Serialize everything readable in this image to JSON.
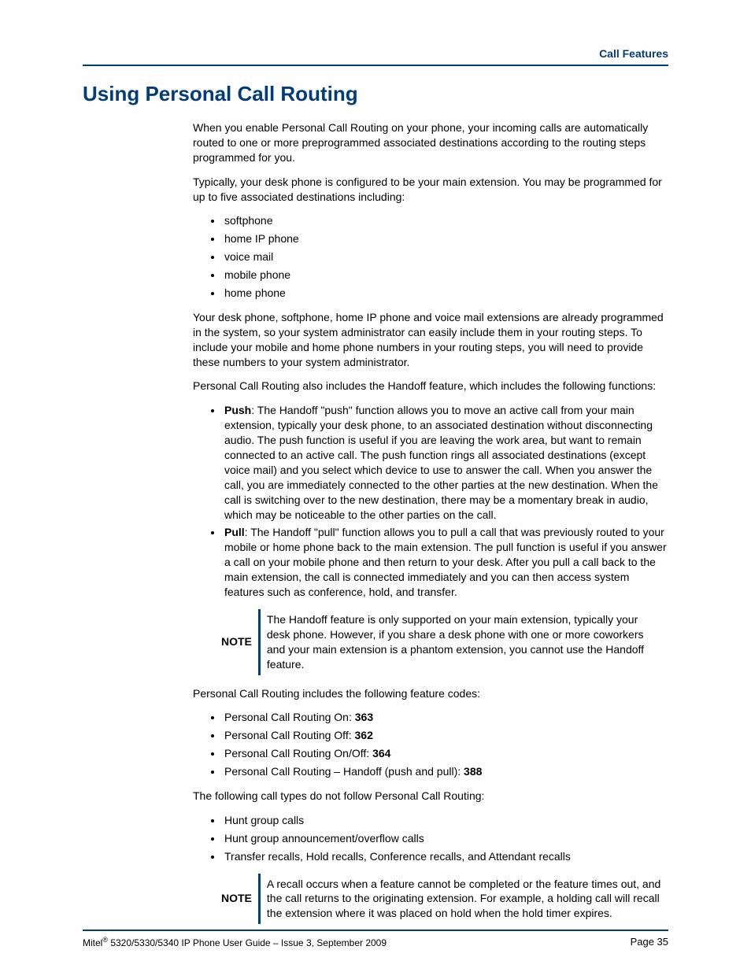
{
  "header": {
    "section": "Call Features"
  },
  "title": "Using Personal Call Routing",
  "p1": "When you enable Personal Call Routing on your phone, your incoming calls are automatically routed to one or more preprogrammed associated destinations according to the routing steps programmed for you.",
  "p2": "Typically, your desk phone is configured to be your main extension. You may be programmed for up to five associated destinations including:",
  "dest": [
    "softphone",
    "home IP phone",
    "voice mail",
    "mobile phone",
    "home phone"
  ],
  "p3": "Your desk phone, softphone, home IP phone and voice mail extensions are already programmed in the system, so your system administrator can easily include them in your routing steps. To include your mobile and home phone numbers in your routing steps, you will need to provide these numbers to your system administrator.",
  "p4": "Personal Call Routing also includes the Handoff feature, which includes the following functions:",
  "push": {
    "label": "Push",
    "text": ": The Handoff \"push\" function allows you to move an active call from your main extension, typically your desk phone, to an associated destination without disconnecting audio. The push function is useful if you are leaving the work area, but want to remain connected to an active call. The push function rings all associated destinations (except voice mail) and you select which device to use to answer the call. When you answer the call, you are immediately connected to the other parties at the new destination. When the call is switching over to the new destination, there may be a momentary break in audio, which may be noticeable to the other parties on the call."
  },
  "pull": {
    "label": "Pull",
    "text": ": The Handoff \"pull\" function allows you to pull a call that was previously routed to your mobile or home phone back to the main extension. The pull function is useful if you answer a call on your mobile phone and then return to your desk. After you pull a call back to the main extension, the call is connected immediately and you can then access system features such as conference, hold, and transfer."
  },
  "note1": {
    "label": "NOTE",
    "text": "The Handoff feature is only supported on your main extension, typically your desk phone. However, if you share a desk phone with one or more coworkers and your main extension is a phantom extension, you cannot use the Handoff feature."
  },
  "p5": "Personal Call Routing includes the following feature codes:",
  "codes": {
    "c1": {
      "prefix": "Personal Call Routing On: ",
      "val": "363"
    },
    "c2": {
      "prefix": "Personal Call Routing Off: ",
      "val": "362"
    },
    "c3": {
      "prefix": "Personal Call Routing On/Off: ",
      "val": "364"
    },
    "c4": {
      "prefix": "Personal Call Routing – Handoff (push and pull): ",
      "val": "388"
    }
  },
  "p6": "The following call types do not follow Personal Call Routing:",
  "exclude": [
    "Hunt group calls",
    "Hunt group announcement/overflow calls",
    "Transfer recalls, Hold recalls, Conference recalls, and Attendant recalls"
  ],
  "note2": {
    "label": "NOTE",
    "text": "A recall occurs when a feature cannot be completed or the feature times out, and the call returns to the originating extension. For example, a holding call will recall the extension where it was placed on hold when the hold timer expires."
  },
  "footer": {
    "brand": "Mitel",
    "reg": "®",
    "doc": " 5320/5330/5340 IP Phone User Guide  – Issue 3, September 2009",
    "page": "Page 35"
  }
}
